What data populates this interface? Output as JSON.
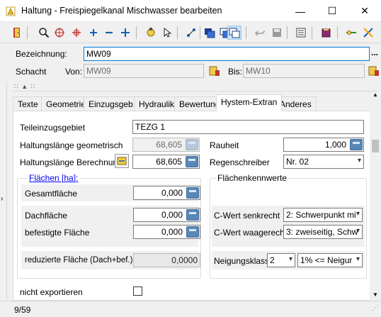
{
  "window": {
    "title": "Haltung - Freispiegelkanal Mischwasser bearbeiten",
    "minimize": "—",
    "maximize": "☐",
    "close": "✕"
  },
  "toolbar": {
    "icons": [
      "door-exit-icon",
      "zoom-icon",
      "zoom-extent-icon",
      "crosshair-icon",
      "plus-icon",
      "minus-icon",
      "move-icon",
      "snap-icon",
      "pointer-icon",
      "connect-icon",
      "layer-1-icon",
      "layer-2-icon",
      "layer-3-icon",
      "undo-icon",
      "save-icon",
      "list-icon",
      "book-icon",
      "route-icon",
      "tools-icon"
    ]
  },
  "header": {
    "bezeichnung_label": "Bezeichnung:",
    "bezeichnung_value": "MW09",
    "schacht_label": "Schacht",
    "von_label": "Von:",
    "von_value": "MW09",
    "bis_label": "Bis:",
    "bis_value": "MW10",
    "more": "..."
  },
  "tabs": [
    "Texte",
    "Geometrie",
    "Einzugsgeb.",
    "Hydraulik",
    "Bewertung",
    "Hystem-Extran",
    "Anderes"
  ],
  "active_tab": "Hystem-Extran",
  "form": {
    "teileinzugsgebiet_label": "Teileinzugsgebiet",
    "teileinzugsgebiet_value": "TEZG 1",
    "laenge_geo_label": "Haltungslänge geometrisch",
    "laenge_geo_value": "68,605",
    "laenge_ber_label": "Haltungslänge Berechnung",
    "laenge_ber_value": "68,605",
    "rauheit_label": "Rauheit",
    "rauheit_value": "1,000",
    "regenschreiber_label": "Regenschreiber",
    "regenschreiber_value": "Nr. 02",
    "flaechen_title": "Flächen [ha]:",
    "gesamt_label": "Gesamtfläche",
    "gesamt_value": "0,000",
    "dach_label": "Dachfläche",
    "dach_value": "0,000",
    "befestigt_label": "befestigte Fläche",
    "befestigt_value": "0,000",
    "reduziert_label": "reduzierte Fläche (Dach+bef.)",
    "reduziert_value": "0,0000",
    "kennwerte_title": "Flächenkennwerte",
    "c_senk_label": "C-Wert senkrecht",
    "c_senk_value": "2: Schwerpunkt mi",
    "c_waag_label": "C-Wert waagerecht",
    "c_waag_value": "3: zweiseitig, Schw",
    "neigung_label": "Neigungsklasse",
    "neigung_value": "2",
    "neigung_range": "1% <= Neigur",
    "nicht_export_label": "nicht exportieren"
  },
  "status": {
    "record": "9/59"
  }
}
